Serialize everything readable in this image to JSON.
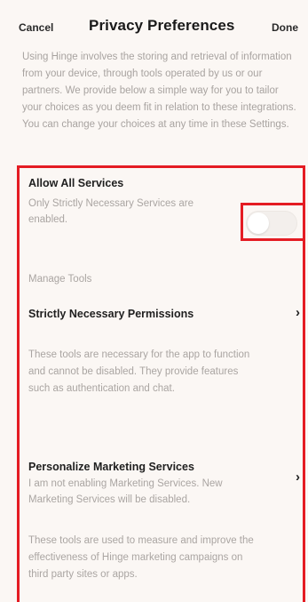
{
  "header": {
    "cancel_label": "Cancel",
    "title": "Privacy Preferences",
    "done_label": "Done"
  },
  "intro_text": "Using Hinge involves the storing and retrieval of information from your device, through tools operated by us or our partners. We provide below a simple way for you to tailor your choices as you deem fit in relation to these integrations. You can change your choices at any time in these Settings.",
  "allow_all": {
    "title": "Allow All Services",
    "description": "Only Strictly Necessary Services are enabled.",
    "enabled": false
  },
  "manage_tools_label": "Manage Tools",
  "strictly_necessary": {
    "title": "Strictly Necessary Permissions",
    "chevron": "›",
    "description": "These tools are necessary for the app to function and cannot be disabled. They provide features such as authentication and chat."
  },
  "marketing": {
    "title": "Personalize Marketing Services",
    "status": "I am not enabling Marketing Services. New Marketing Services will be disabled.",
    "chevron": "›",
    "description": "These tools are used to measure and improve the effectiveness of Hinge marketing campaigns on third party sites or apps."
  },
  "colors": {
    "highlight": "#e41c23",
    "background": "#fbf7f4",
    "muted_text": "#aaa5a2"
  }
}
